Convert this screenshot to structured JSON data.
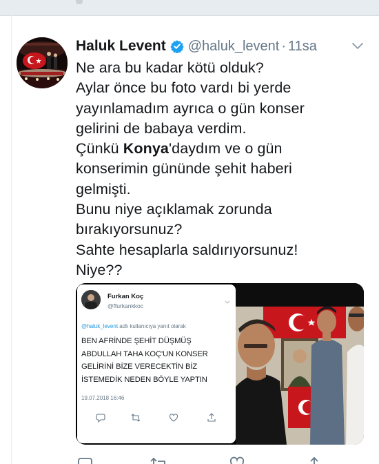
{
  "tweet": {
    "author_name": "Haluk Levent",
    "verified": true,
    "handle": "@haluk_levent",
    "separator": "·",
    "time": "11sa",
    "lines": {
      "l1": "Ne ara bu kadar kötü olduk?",
      "l2": "Aylar önce bu foto vardı bi yerde",
      "l3": "yayınlamadım ayrıca o gün konser",
      "l4": "gelirini de babaya verdim.",
      "l5_pre": "Çünkü ",
      "l5_bold": "Konya",
      "l5_post": "'daydım ve o gün",
      "l6": "konserimin gününde şehit haberi",
      "l7": "gelmişti.",
      "l8": "Bunu niye açıklamak zorunda",
      "l9": "bırakıyorsunuz?",
      "l10": "Sahte hesaplarla saldırıyorsunuz!",
      "l11": "Niye??"
    },
    "accent_color": "#1da1f2",
    "text_color": "#14171a",
    "muted_color": "#657786"
  },
  "embedded_tweet": {
    "author_name": "Furkan Koç",
    "handle": "@ffurkankkoc",
    "reply_mention": "@haluk_levent",
    "reply_suffix": " adlı kullanıcıya yanıt olarak",
    "body": {
      "b1": "BEN AFRİNDE ŞEHİT DÜŞMÜŞ",
      "b2": "ABDULLAH TAHA KOÇ'UN KONSER",
      "b3": "GELİRİNİ BİZE VERECEKTİN BİZ",
      "b4": "İSTEMEDİK NEDEN BÖYLE YAPTIN"
    },
    "date": "19.07.2018 16:46"
  },
  "icons": {
    "verified": "verified-badge-icon",
    "caret": "chevron-down-icon",
    "reply": "reply-icon",
    "retweet": "retweet-icon",
    "like": "heart-icon",
    "share": "share-icon"
  }
}
